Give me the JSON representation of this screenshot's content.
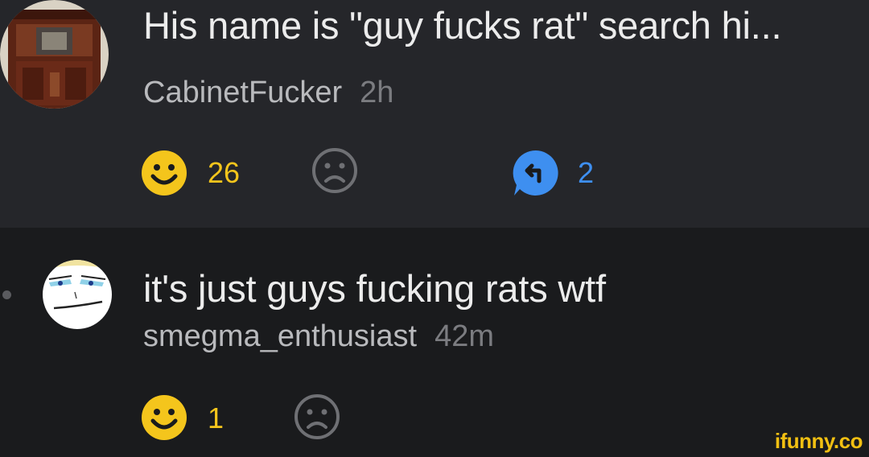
{
  "comments": [
    {
      "text": "His name is \"guy fucks rat\" search hi...",
      "username": "CabinetFucker",
      "time": "2h",
      "smile_count": "26",
      "reply_count": "2"
    },
    {
      "text": "it's just guys fucking rats wtf",
      "username": "smegma_enthusiast",
      "time": "42m",
      "smile_count": "1"
    }
  ],
  "watermark": "ifunny.co",
  "icons": {
    "smile": "smile-icon",
    "frown": "frown-icon",
    "reply": "reply-icon"
  },
  "colors": {
    "smile": "#f4c51c",
    "reply": "#3e8ff0",
    "frown": "#6f7074"
  }
}
